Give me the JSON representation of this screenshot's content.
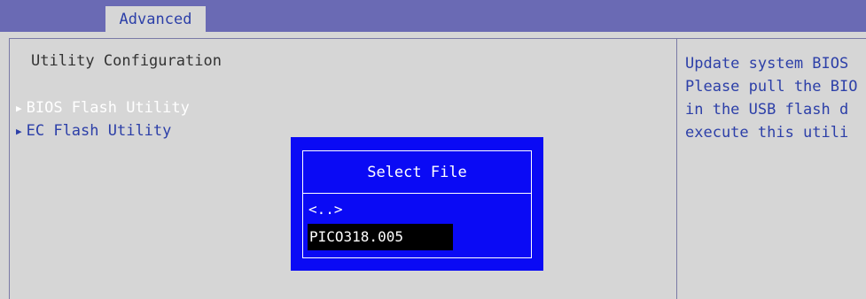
{
  "header": {
    "tab_label": "Advanced"
  },
  "main": {
    "section_title": "Utility Configuration",
    "items": [
      {
        "label": "BIOS Flash Utility",
        "icon": "triangle-right-icon"
      },
      {
        "label": "EC Flash Utility",
        "icon": "triangle-right-icon"
      }
    ]
  },
  "help": {
    "lines": [
      "Update system BIOS",
      "Please pull the BIO",
      "in the USB flash d",
      "execute this utili"
    ]
  },
  "dialog": {
    "title": "Select File",
    "files": [
      "<..>",
      "PICO318.005"
    ]
  },
  "colors": {
    "topbar": "#6a6ab4",
    "background": "#d6d6d6",
    "text_blue": "#2c3fa8",
    "dialog_blue": "#0a0af5"
  }
}
